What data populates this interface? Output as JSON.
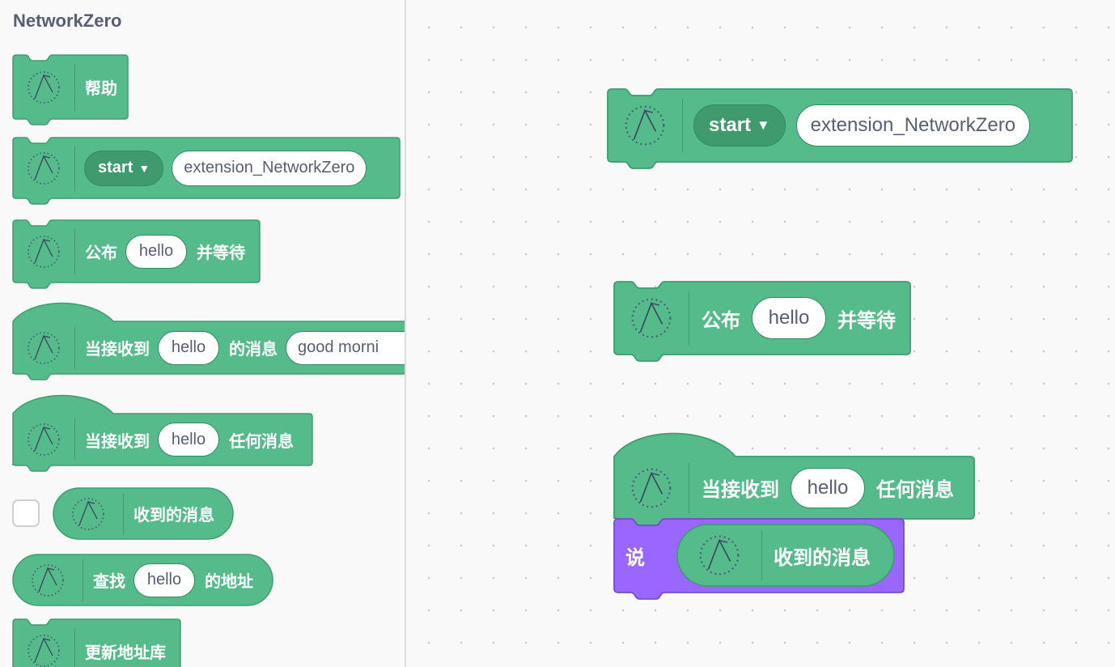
{
  "palette": {
    "category_title": "NetworkZero",
    "blocks": {
      "help": {
        "label": "帮助"
      },
      "start": {
        "dropdown": "start",
        "input": "extension_NetworkZero"
      },
      "publish": {
        "pre": "公布",
        "input": "hello",
        "post": "并等待"
      },
      "when_msg": {
        "pre": "当接收到",
        "input1": "hello",
        "mid": "的消息",
        "input2": "good morni"
      },
      "when_any": {
        "pre": "当接收到",
        "input": "hello",
        "post": "任何消息"
      },
      "reporter_received": {
        "label": "收到的消息",
        "checkbox_checked": false
      },
      "find": {
        "pre": "查找",
        "input": "hello",
        "post": "的地址"
      },
      "update": {
        "label": "更新地址库"
      }
    }
  },
  "workspace": {
    "start": {
      "dropdown": "start",
      "input": "extension_NetworkZero"
    },
    "publish": {
      "pre": "公布",
      "input": "hello",
      "post": "并等待"
    },
    "when_any": {
      "pre": "当接收到",
      "input": "hello",
      "post": "任何消息"
    },
    "say": {
      "label": "说",
      "reporter": "收到的消息"
    }
  },
  "colors": {
    "extension_fill": "#55bb8b",
    "extension_border": "#3e9d72",
    "looks_fill": "#9966ff",
    "looks_border": "#774dcb",
    "text_dark": "#575e75"
  },
  "icons": {
    "extension": "networkzero-wifi-icon"
  }
}
